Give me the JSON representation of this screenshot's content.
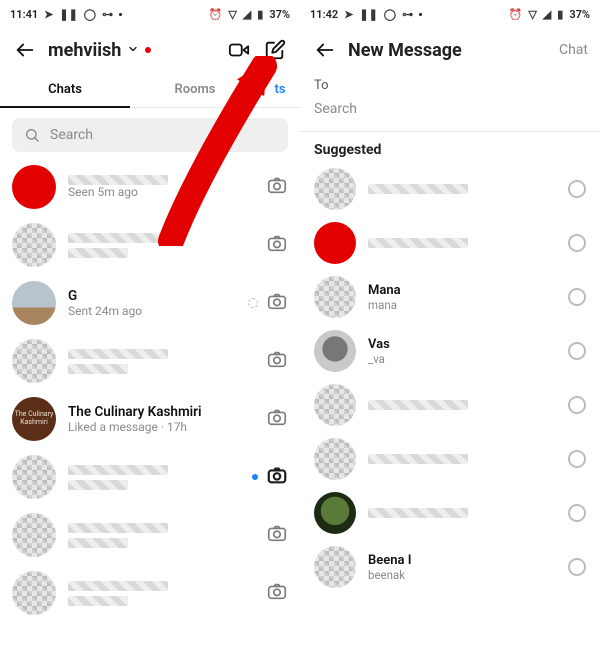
{
  "status": {
    "time_left": "11:41",
    "time_right": "11:42",
    "battery": "37%"
  },
  "left": {
    "header": {
      "username": "mehviish"
    },
    "tabs": {
      "chats": "Chats",
      "rooms": "Rooms",
      "requests": "ts"
    },
    "search_placeholder": "Search",
    "rows": [
      {
        "name": "",
        "sub": "Seen 5m ago",
        "avatar": "red",
        "right": "cam"
      },
      {
        "name": "",
        "sub": "",
        "avatar": "mosaic",
        "right": "cam"
      },
      {
        "name": "G",
        "sub": "Sent 24m ago",
        "avatar": "landscape",
        "right": "pending-cam"
      },
      {
        "name": "",
        "sub": "",
        "avatar": "mosaic",
        "right": "cam"
      },
      {
        "name": "The Culinary Kashmiri",
        "sub": "Liked a message · 17h",
        "avatar": "brown",
        "right": "cam"
      },
      {
        "name": "",
        "sub": "",
        "avatar": "mosaic",
        "right": "unread-cam"
      },
      {
        "name": "",
        "sub": "",
        "avatar": "mosaic",
        "right": "cam"
      },
      {
        "name": "",
        "sub": "",
        "avatar": "mosaic",
        "right": "cam"
      }
    ]
  },
  "right": {
    "header": {
      "title": "New Message",
      "action": "Chat"
    },
    "to_label": "To",
    "search_placeholder": "Search",
    "section": "Suggested",
    "rows": [
      {
        "name": "",
        "sub": "",
        "avatar": "mosaic"
      },
      {
        "name": "",
        "sub": "",
        "avatar": "red"
      },
      {
        "name": "Mana",
        "sub": "mana",
        "avatar": "mosaic"
      },
      {
        "name": "Vas",
        "sub": "_va",
        "avatar": "gray-blob"
      },
      {
        "name": "",
        "sub": "",
        "avatar": "mosaic"
      },
      {
        "name": "",
        "sub": "",
        "avatar": "mosaic"
      },
      {
        "name": "",
        "sub": "",
        "avatar": "green"
      },
      {
        "name": "Beena I",
        "sub": "beenak",
        "avatar": "mosaic"
      }
    ]
  },
  "brown_avatar_text": "The Culinary Kashmiri"
}
